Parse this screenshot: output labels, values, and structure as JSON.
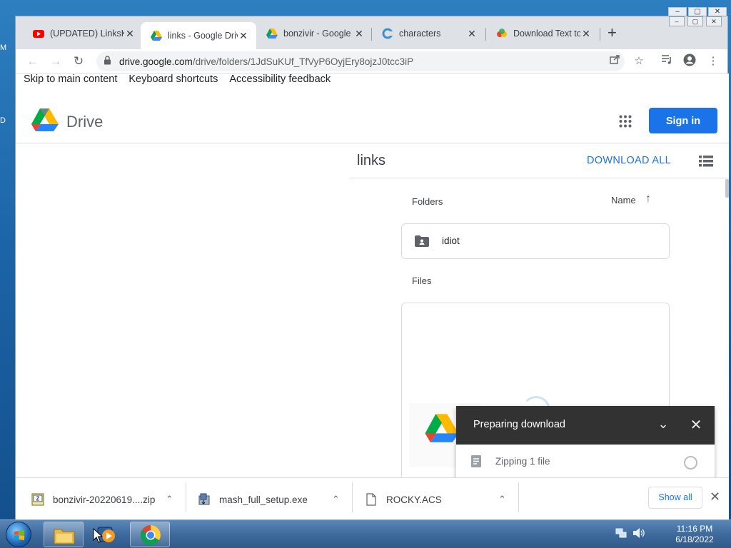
{
  "desktop": {
    "frag_left_top": "M",
    "frag_left_mid": "D"
  },
  "tabs": [
    {
      "title": "(UPDATED) LinksK",
      "favicon": "youtube-icon",
      "active": false
    },
    {
      "title": "links - Google Driv",
      "favicon": "google-drive-icon",
      "active": true
    },
    {
      "title": "bonzivir - Google",
      "favicon": "google-drive-icon",
      "active": false
    },
    {
      "title": "characters",
      "favicon": "site-swirl-icon",
      "active": false
    },
    {
      "title": "Download Text to",
      "favicon": "colorful-site-icon",
      "active": false
    }
  ],
  "address_bar": {
    "host": "drive.google.com",
    "path": "/drive/folders/1JdSuKUf_TfVyP6OyjEry8ojzJ0tcc3iP"
  },
  "skip_links": [
    "Skip to main content",
    "Keyboard shortcuts",
    "Accessibility feedback"
  ],
  "drive": {
    "product_name": "Drive",
    "sign_in_label": "Sign in",
    "folder_title": "links",
    "download_all_label": "DOWNLOAD ALL",
    "folders_label": "Folders",
    "sort_label": "Name",
    "files_label": "Files",
    "folders": [
      {
        "name": "idiot"
      }
    ]
  },
  "toast": {
    "title": "Preparing download",
    "status": "Zipping 1 file"
  },
  "downloads": [
    {
      "name": "bonzivir-20220619....zip",
      "icon": "zip-file-icon"
    },
    {
      "name": "mash_full_setup.exe",
      "icon": "installer-icon"
    },
    {
      "name": "ROCKY.ACS",
      "icon": "generic-file-icon"
    }
  ],
  "shelf": {
    "show_all_label": "Show all"
  },
  "taskbar": {
    "time": "11:16 PM",
    "date": "6/18/2022"
  }
}
